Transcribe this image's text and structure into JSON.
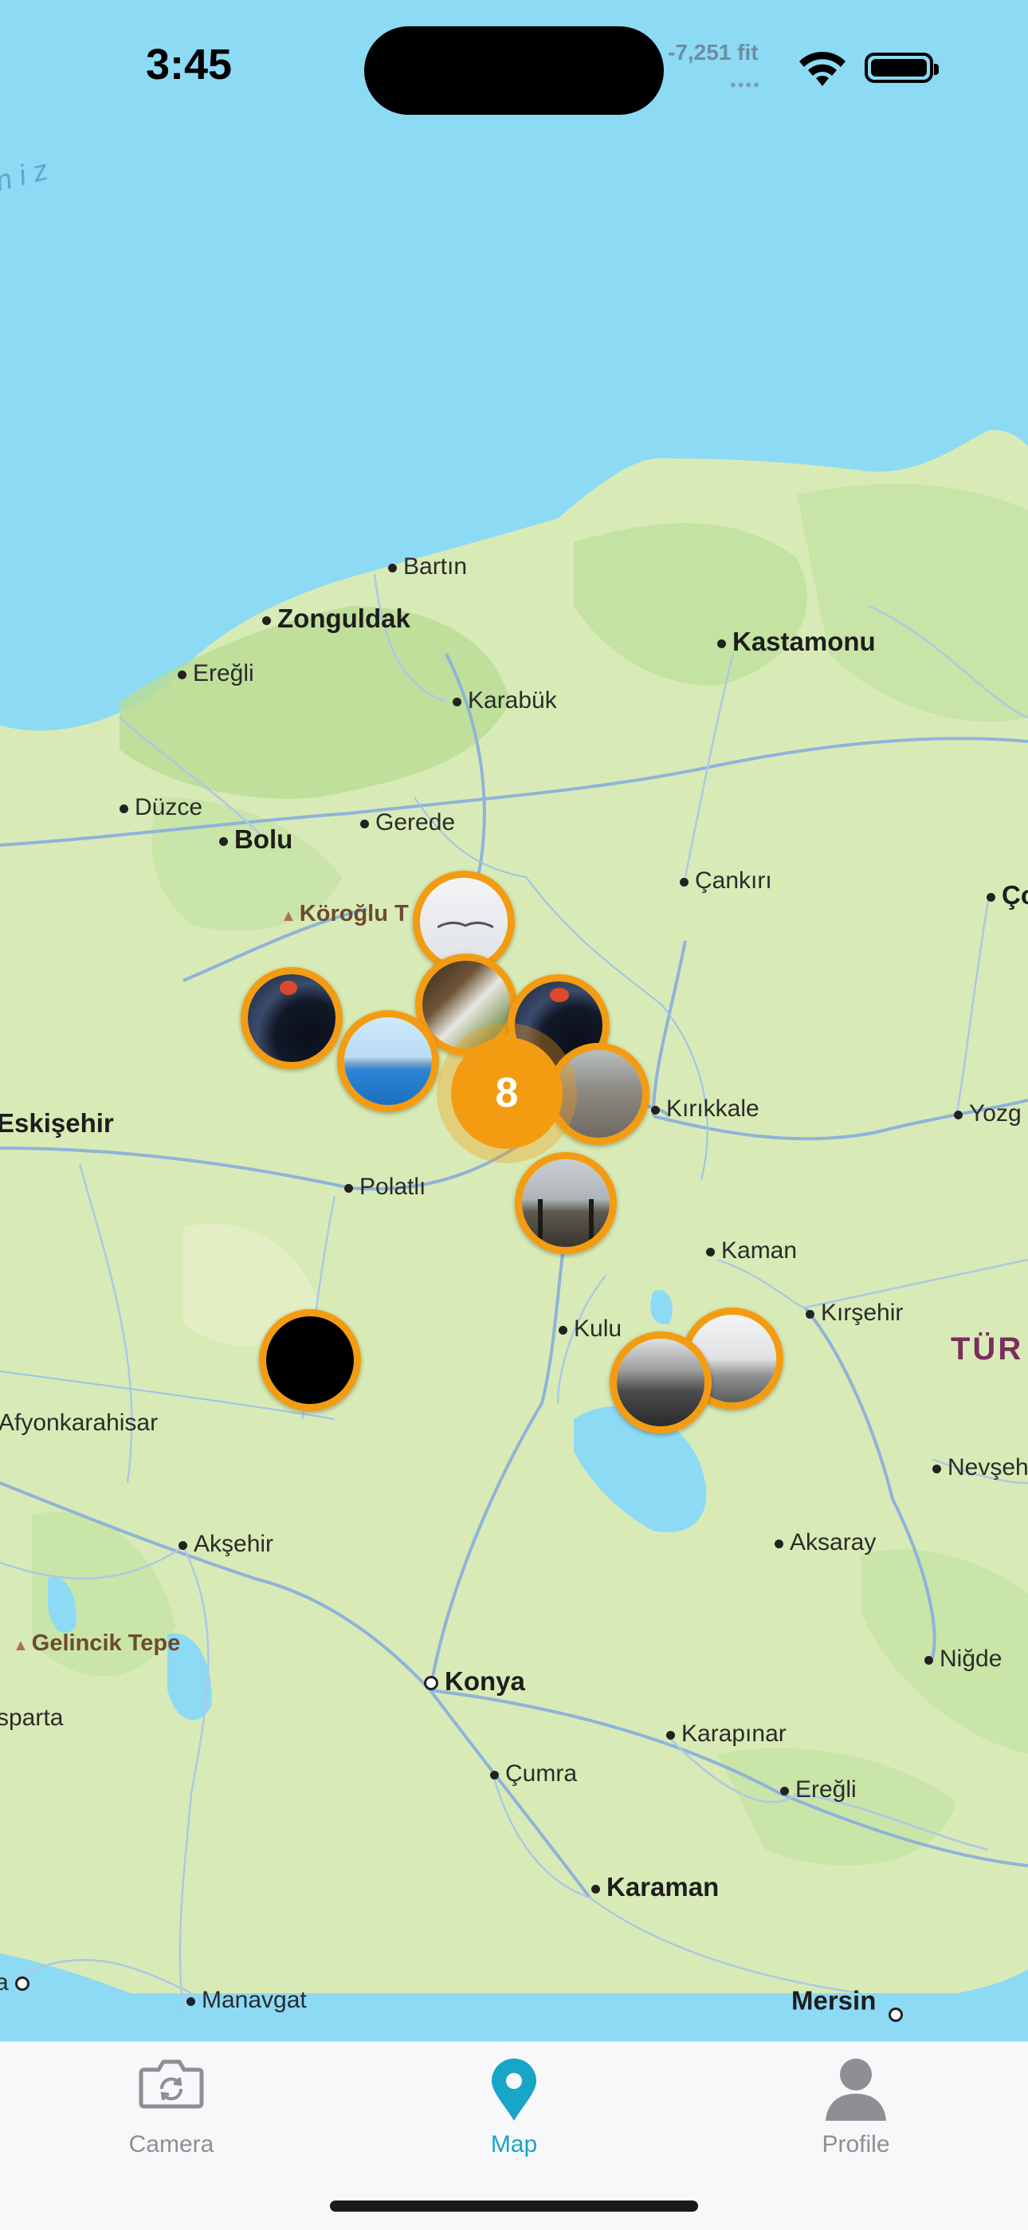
{
  "status_bar": {
    "time": "3:45",
    "elevation": "-7,251 fit",
    "signal_dots": "••••"
  },
  "map": {
    "sea_label": "niz",
    "country_label": "TÜR",
    "cities": [
      {
        "name": "Bartın",
        "big": false
      },
      {
        "name": "Zonguldak",
        "big": true
      },
      {
        "name": "Kastamonu",
        "big": true
      },
      {
        "name": "Ereğli",
        "big": false
      },
      {
        "name": "Karabük",
        "big": false
      },
      {
        "name": "Düzce",
        "big": false
      },
      {
        "name": "Bolu",
        "big": true
      },
      {
        "name": "Gerede",
        "big": false
      },
      {
        "name": "Çankırı",
        "big": false
      },
      {
        "name": "Ço",
        "big": true
      },
      {
        "name": "Eskişehir",
        "big": true
      },
      {
        "name": "Polatlı",
        "big": false
      },
      {
        "name": "Kırıkkale",
        "big": false
      },
      {
        "name": "Yozg",
        "big": false
      },
      {
        "name": "Kaman",
        "big": false
      },
      {
        "name": "Kırşehir",
        "big": false
      },
      {
        "name": "Kulu",
        "big": false
      },
      {
        "name": "Afyonkarahisar",
        "big": false
      },
      {
        "name": "Nevşeh",
        "big": false
      },
      {
        "name": "Akşehir",
        "big": false
      },
      {
        "name": "Aksaray",
        "big": false
      },
      {
        "name": "Niğde",
        "big": false
      },
      {
        "name": "Konya",
        "big": true
      },
      {
        "name": "sparta",
        "big": false
      },
      {
        "name": "Karapınar",
        "big": false
      },
      {
        "name": "Çumra",
        "big": false
      },
      {
        "name": "Ereğli",
        "big": false
      },
      {
        "name": "Karaman",
        "big": true
      },
      {
        "name": "Manavgat",
        "big": false
      },
      {
        "name": "Mersin",
        "big": true
      },
      {
        "name": "a",
        "big": false
      }
    ],
    "peaks": [
      {
        "name": "Köroğlu T"
      },
      {
        "name": "Gelincik Tepe"
      }
    ],
    "photo_markers": [
      {
        "name": "marker-sky"
      },
      {
        "name": "marker-eclipse-1"
      },
      {
        "name": "marker-waterfall"
      },
      {
        "name": "marker-eclipse-2"
      },
      {
        "name": "marker-skyline"
      },
      {
        "name": "marker-road"
      },
      {
        "name": "marker-pier"
      },
      {
        "name": "marker-black"
      },
      {
        "name": "marker-beach"
      },
      {
        "name": "marker-rocks"
      }
    ],
    "cluster_count": "8"
  },
  "tabbar": {
    "tabs": [
      {
        "label": "Camera",
        "icon": "camera-rotate-icon",
        "active": false
      },
      {
        "label": "Map",
        "icon": "map-pin-icon",
        "active": true
      },
      {
        "label": "Profile",
        "icon": "person-icon",
        "active": false
      }
    ]
  },
  "colors": {
    "accent": "#17a5c8",
    "marker": "#f39c12",
    "water": "#8ddaf5",
    "land": "#d8ebb6"
  }
}
